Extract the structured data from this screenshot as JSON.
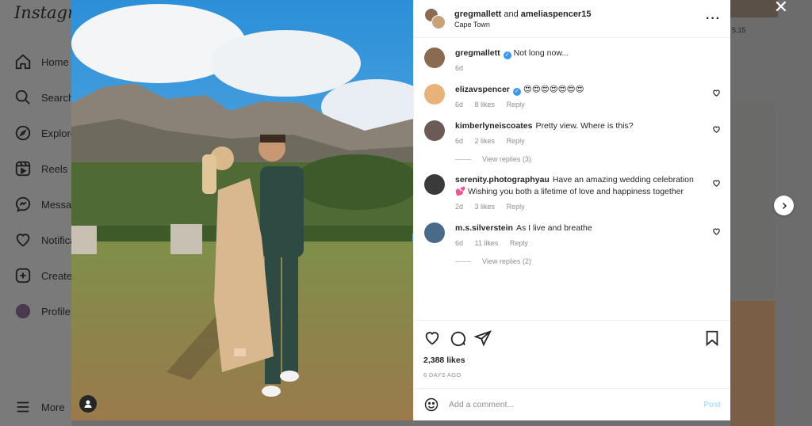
{
  "app": {
    "logo": "Instagram"
  },
  "sidebar": {
    "items": [
      {
        "label": "Home",
        "icon": "home-icon"
      },
      {
        "label": "Search",
        "icon": "search-icon"
      },
      {
        "label": "Explore",
        "icon": "compass-icon"
      },
      {
        "label": "Reels",
        "icon": "reels-icon"
      },
      {
        "label": "Messages",
        "icon": "messenger-icon"
      },
      {
        "label": "Notifications",
        "icon": "heart-icon"
      },
      {
        "label": "Create",
        "icon": "plus-square-icon"
      },
      {
        "label": "Profile",
        "icon": "avatar"
      }
    ],
    "more_label": "More"
  },
  "background": {
    "partial_text": "5.15"
  },
  "post": {
    "header": {
      "user1": "gregmallett",
      "conjunction": "and",
      "user2": "ameliaspencer15",
      "location": "Cape Town"
    },
    "caption": {
      "user": "gregmallett",
      "text": "Not long now...",
      "time": "6d"
    },
    "comments": [
      {
        "user": "elizavspencer",
        "verified": true,
        "text": "😍😍😍😍😍😍😍",
        "time": "6d",
        "likes": "8 likes",
        "reply": "Reply",
        "avatar_color": "#e8b27a"
      },
      {
        "user": "kimberlyneiscoates",
        "verified": false,
        "text": "Pretty view. Where is this?",
        "time": "6d",
        "likes": "2 likes",
        "reply": "Reply",
        "avatar_color": "#6b5a55",
        "replies": "View replies (3)"
      },
      {
        "user": "serenity.photographyau",
        "verified": false,
        "text": "Have an amazing wedding celebration 💕 Wishing you both a lifetime of love and happiness together",
        "time": "2d",
        "likes": "3 likes",
        "reply": "Reply",
        "avatar_color": "#3a3a3a"
      },
      {
        "user": "m.s.silverstein",
        "verified": false,
        "text": "As I live and breathe",
        "time": "6d",
        "likes": "11 likes",
        "reply": "Reply",
        "avatar_color": "#4a6a8a",
        "replies": "View replies (2)"
      }
    ],
    "likes": "2,388 likes",
    "date": "6 DAYS AGO",
    "add_comment_placeholder": "Add a comment...",
    "post_label": "Post"
  },
  "colors": {
    "accent": "#0095f6",
    "post_disabled": "#b2dffc",
    "verified": "#3897f0"
  }
}
